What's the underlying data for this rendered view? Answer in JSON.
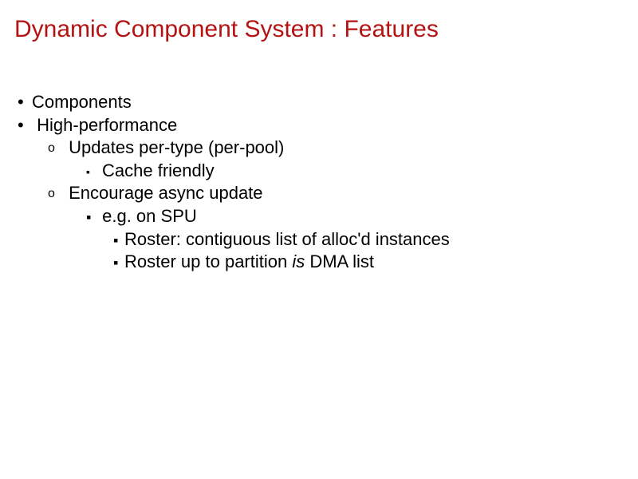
{
  "title": "Dynamic Component System : Features",
  "bullets": {
    "b1": "Components",
    "b2": "High-performance",
    "b2_1": "Updates per-type (per-pool)",
    "b2_1_1": "Cache friendly",
    "b2_2": "Encourage async update",
    "b2_2_1": "e.g. on SPU",
    "b2_2_1_1": "Roster: contiguous list of alloc'd instances",
    "b2_2_1_2_pre": "Roster up to partition ",
    "b2_2_1_2_em": "is",
    "b2_2_1_2_post": " DMA list"
  }
}
